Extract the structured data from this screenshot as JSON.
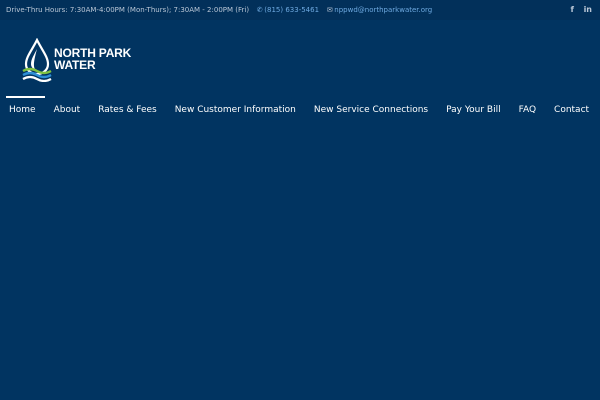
{
  "topbar": {
    "hours": "Drive-Thru Hours: 7:30AM-4:00PM (Mon-Thurs); 7:30AM - 2:00PM (Fri)",
    "phone": "(815) 633-5461",
    "email": "nppwd@northparkwater.org",
    "social": {
      "facebook": "f",
      "linkedin": "in"
    }
  },
  "logo": {
    "line1": "NORTH PARK",
    "line2": "WATER"
  },
  "nav": {
    "items": [
      {
        "label": "Home"
      },
      {
        "label": "About"
      },
      {
        "label": "Rates & Fees"
      },
      {
        "label": "New Customer Information"
      },
      {
        "label": "New Service Connections"
      },
      {
        "label": "Pay Your Bill"
      },
      {
        "label": "FAQ"
      },
      {
        "label": "Contact"
      }
    ]
  },
  "colors": {
    "background": "#013461",
    "topbar": "#02305a",
    "link": "#6ea9e0",
    "wave_green": "#7fc241",
    "wave_blue": "#2e8fd6"
  }
}
